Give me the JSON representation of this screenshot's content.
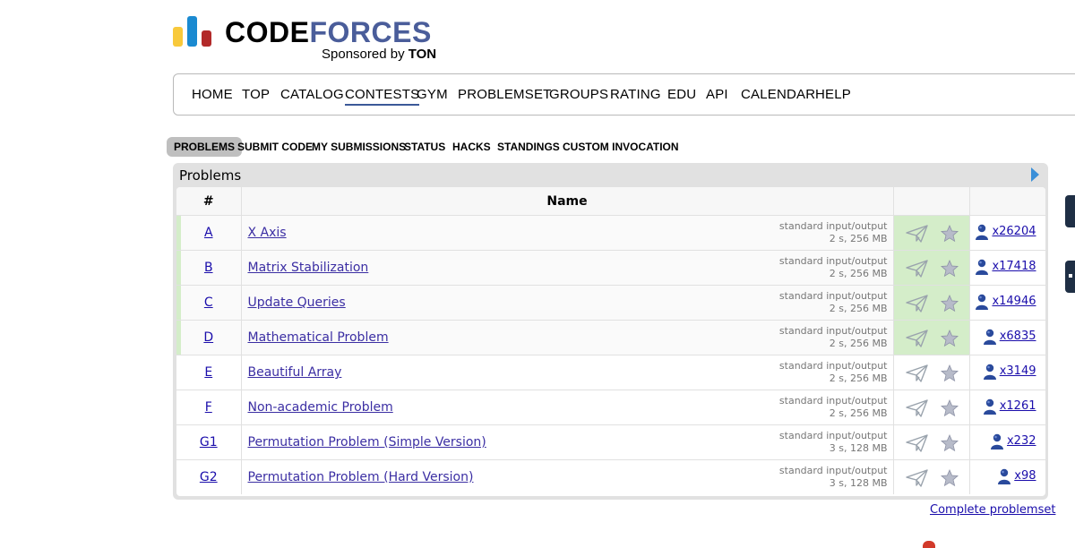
{
  "logo": {
    "word_part1": "CODE",
    "word_part2": "FORCES",
    "sponsor_prefix": "Sponsored by",
    "sponsor_name": "TON"
  },
  "main_nav": [
    {
      "label": "HOME"
    },
    {
      "label": "TOP"
    },
    {
      "label": "CATALOG"
    },
    {
      "label": "CONTESTS",
      "active": true
    },
    {
      "label": "GYM"
    },
    {
      "label": "PROBLEMSET"
    },
    {
      "label": "GROUPS"
    },
    {
      "label": "RATING"
    },
    {
      "label": "EDU"
    },
    {
      "label": "API"
    },
    {
      "label": "CALENDAR"
    },
    {
      "label": "HELP"
    }
  ],
  "sub_nav": [
    {
      "label": "PROBLEMS",
      "active": true
    },
    {
      "label": "SUBMIT CODE"
    },
    {
      "label": "MY SUBMISSIONS"
    },
    {
      "label": "STATUS"
    },
    {
      "label": "HACKS"
    },
    {
      "label": "STANDINGS"
    },
    {
      "label": "CUSTOM INVOCATION"
    }
  ],
  "problems": {
    "caption": "Problems",
    "col_index": "#",
    "col_name": "Name",
    "rows": [
      {
        "index": "A",
        "name": "X Axis",
        "io": "standard input/output",
        "limits": "2 s, 256 MB",
        "solved": "x26204",
        "accepted": true
      },
      {
        "index": "B",
        "name": "Matrix Stabilization",
        "io": "standard input/output",
        "limits": "2 s, 256 MB",
        "solved": "x17418",
        "accepted": true
      },
      {
        "index": "C",
        "name": "Update Queries",
        "io": "standard input/output",
        "limits": "2 s, 256 MB",
        "solved": "x14946",
        "accepted": true
      },
      {
        "index": "D",
        "name": "Mathematical Problem",
        "io": "standard input/output",
        "limits": "2 s, 256 MB",
        "solved": "x6835",
        "accepted": true
      },
      {
        "index": "E",
        "name": "Beautiful Array",
        "io": "standard input/output",
        "limits": "2 s, 256 MB",
        "solved": "x3149",
        "accepted": false
      },
      {
        "index": "F",
        "name": "Non-academic Problem",
        "io": "standard input/output",
        "limits": "2 s, 256 MB",
        "solved": "x1261",
        "accepted": false
      },
      {
        "index": "G1",
        "name": "Permutation Problem (Simple Version)",
        "io": "standard input/output",
        "limits": "3 s, 128 MB",
        "solved": "x232",
        "accepted": false
      },
      {
        "index": "G2",
        "name": "Permutation Problem (Hard Version)",
        "io": "standard input/output",
        "limits": "3 s, 128 MB",
        "solved": "x98",
        "accepted": false
      }
    ]
  },
  "complete_link": "Complete problemset",
  "colors": {
    "accepted_bg": "#d4edc9",
    "link": "#1a0dab",
    "nav_active": "#3b5998"
  },
  "icons": {
    "submit": "paper-plane-icon",
    "favorite": "star-icon",
    "solvers": "user-icon",
    "expand": "triangle-right-icon"
  }
}
